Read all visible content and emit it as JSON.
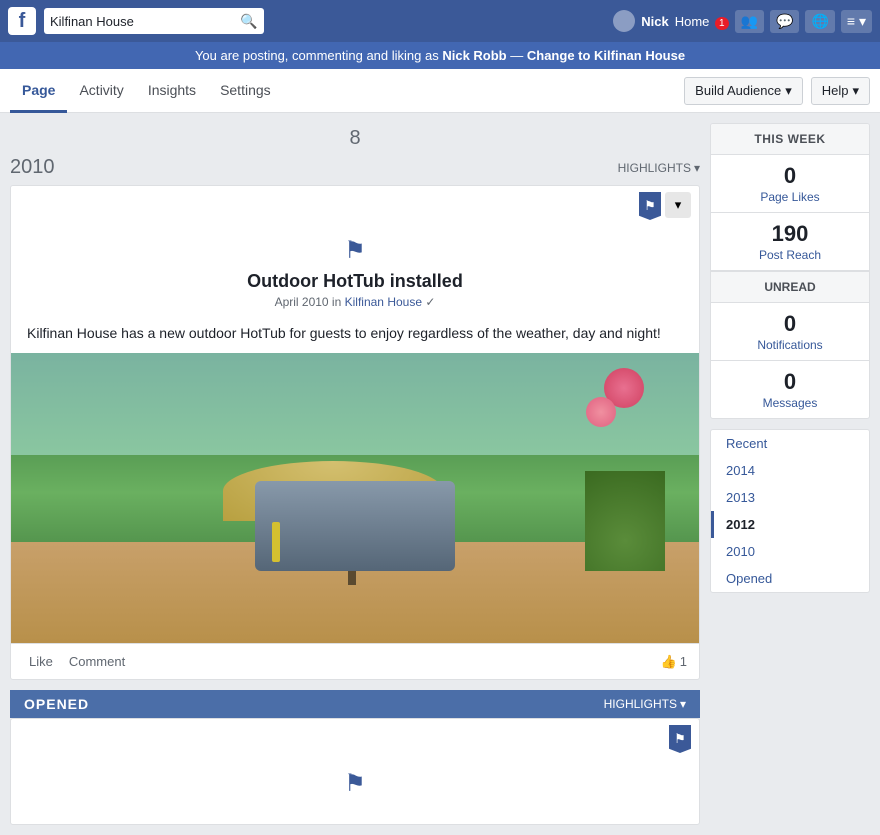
{
  "topNav": {
    "fbLogo": "f",
    "searchValue": "Kilfinan House",
    "searchPlaceholder": "Search",
    "userName": "Nick",
    "homeLabel": "Home",
    "homeBadge": "1"
  },
  "notificationBar": {
    "text": "You are posting, commenting and liking as ",
    "boldName": "Nick Robb",
    "separator": " — ",
    "changeText": "Change to Kilfinan House"
  },
  "secondaryNav": {
    "tabs": [
      {
        "id": "page",
        "label": "Page",
        "active": true
      },
      {
        "id": "activity",
        "label": "Activity",
        "active": false
      },
      {
        "id": "insights",
        "label": "Insights",
        "active": false
      },
      {
        "id": "settings",
        "label": "Settings",
        "active": false
      }
    ],
    "buildAudienceLabel": "Build Audience",
    "helpLabel": "Help"
  },
  "timeline": {
    "topNumber": "8",
    "yearSection": {
      "year": "2010",
      "highlightsLabel": "HIGHLIGHTS"
    },
    "post": {
      "milestoneIcon": "⚑",
      "title": "Outdoor HotTub installed",
      "subtitle": "April 2010 in",
      "pageLink": "Kilfinan House",
      "verifiedIcon": "✓",
      "body": "Kilfinan House has a new outdoor HotTub for guests to enjoy regardless of the weather, day and night!",
      "likeLabel": "Like",
      "commentLabel": "Comment",
      "likeCount": "1"
    },
    "openedSection": {
      "label": "OPENED",
      "highlightsLabel": "HIGHLIGHTS"
    }
  },
  "sidebar": {
    "thisWeekLabel": "THIS WEEK",
    "stats": [
      {
        "number": "0",
        "label": "Page Likes"
      },
      {
        "number": "190",
        "label": "Post Reach"
      }
    ],
    "unreadLabel": "UNREAD",
    "unreadStats": [
      {
        "number": "0",
        "label": "Notifications"
      },
      {
        "number": "0",
        "label": "Messages"
      }
    ],
    "timelineNav": [
      {
        "id": "recent",
        "label": "Recent",
        "active": false
      },
      {
        "id": "2014",
        "label": "2014",
        "active": false
      },
      {
        "id": "2013",
        "label": "2013",
        "active": false
      },
      {
        "id": "2012",
        "label": "2012",
        "active": true
      },
      {
        "id": "2010",
        "label": "2010",
        "active": false
      },
      {
        "id": "opened",
        "label": "Opened",
        "active": false
      }
    ]
  }
}
